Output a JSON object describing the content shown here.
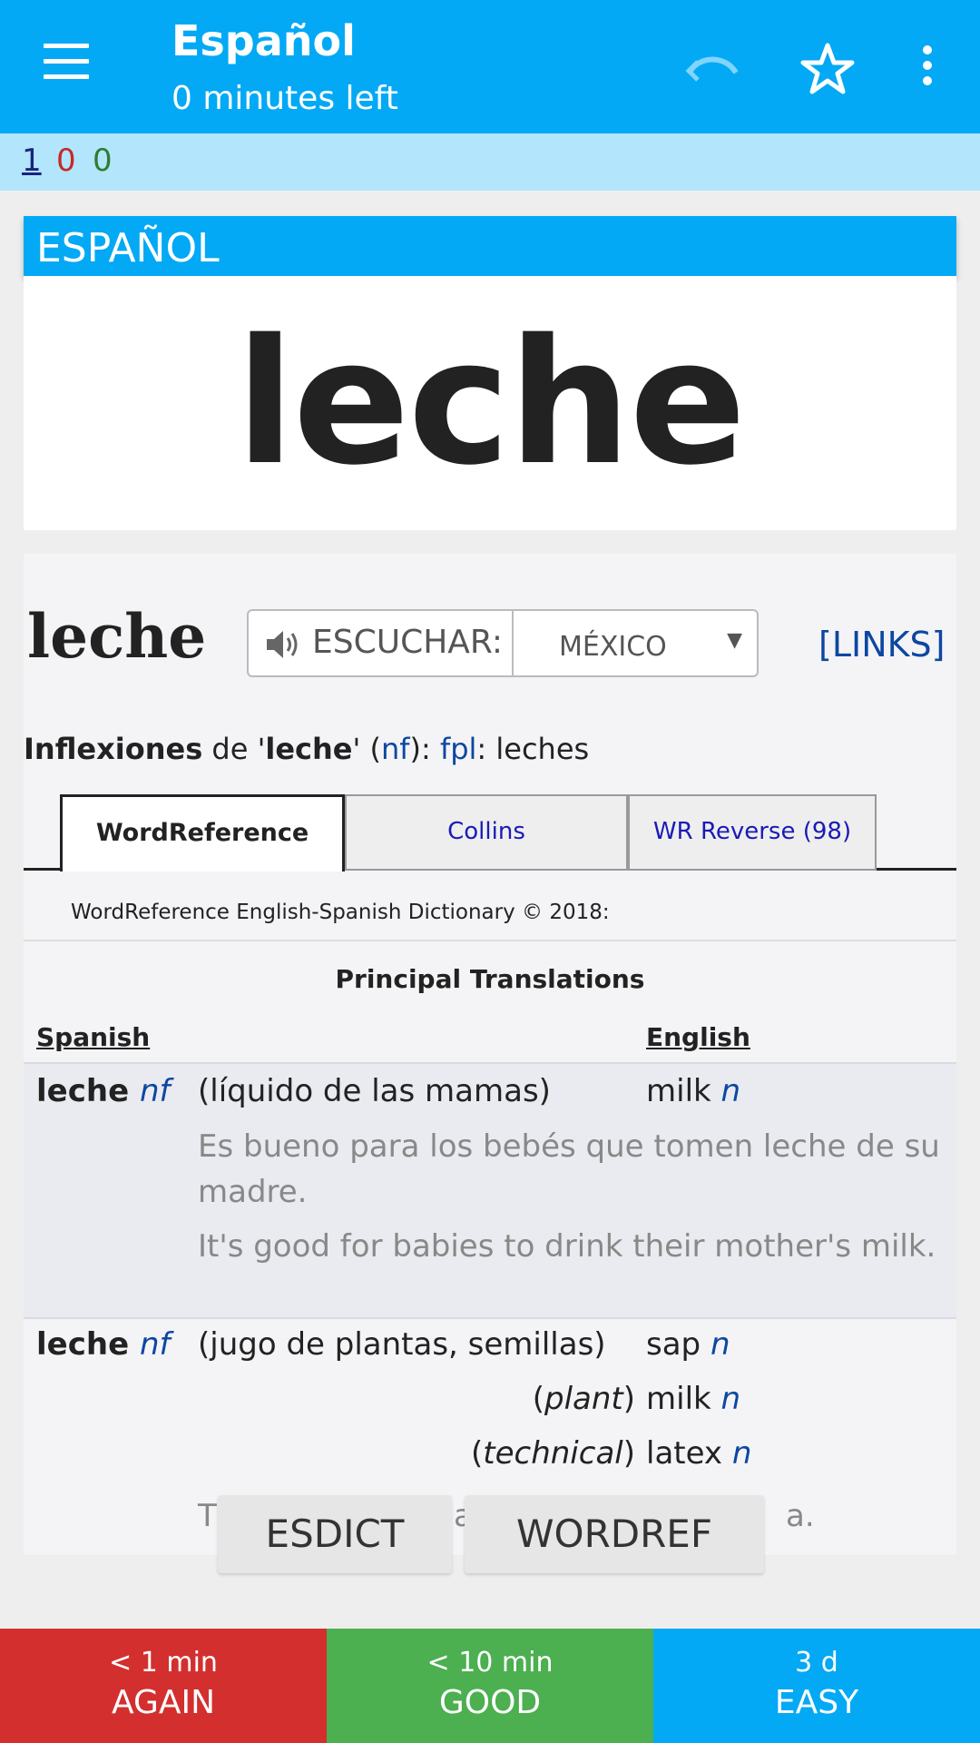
{
  "appbar": {
    "title": "Español",
    "subtitle": "0 minutes left",
    "icons": [
      "menu-icon",
      "undo-icon",
      "star-icon",
      "more-vert-icon"
    ]
  },
  "counts": {
    "new": "1",
    "learning": "0",
    "review": "0"
  },
  "card": {
    "deck_label": "ESPAÑOL",
    "front_word": "leche"
  },
  "wordref": {
    "headword": "leche",
    "listen_label": "ESCUCHAR:",
    "dialect": "MÉXICO",
    "links": "[LINKS]",
    "inflections": {
      "label": "Inflexiones",
      "de": "de '",
      "word": "leche",
      "q": "' (",
      "pos": "nf",
      "close": "):",
      "fpl": "fpl",
      "colon": ":",
      "plural": "leches"
    },
    "tabs": [
      "WordReference",
      "Collins",
      "WR Reverse (98)"
    ],
    "copyright": "WordReference English-Spanish Dictionary © 2018:",
    "section_title": "Principal Translations",
    "col_spanish": "Spanish",
    "col_english": "English",
    "entries": [
      {
        "term": "leche",
        "pos": "nf",
        "sense": "(líquido de las mamas)",
        "translation": "milk",
        "tpos": "n",
        "example_es": "Es bueno para los bebés que tomen leche de su madre.",
        "example_en": "It's good for babies to drink their mother's milk."
      },
      {
        "term": "leche",
        "pos": "nf",
        "sense": "(jugo de plantas, semillas)",
        "translation": "sap",
        "tpos": "n",
        "extra": [
          {
            "ctx": "plant",
            "translation": "milk",
            "tpos": "n"
          },
          {
            "ctx": "technical",
            "translation": "latex",
            "tpos": "n"
          }
        ],
        "partial_example_start": "T",
        "partial_example_mid": "a",
        "partial_example_end": "a."
      }
    ]
  },
  "floating_buttons": {
    "esdict": "ESDICT",
    "wordref": "WORDREF"
  },
  "answers": [
    {
      "interval": "< 1 min",
      "label": "AGAIN",
      "color": "#d32f2f"
    },
    {
      "interval": "< 10 min",
      "label": "GOOD",
      "color": "#4caf50"
    },
    {
      "interval": "3 d",
      "label": "EASY",
      "color": "#03a9f4"
    }
  ]
}
